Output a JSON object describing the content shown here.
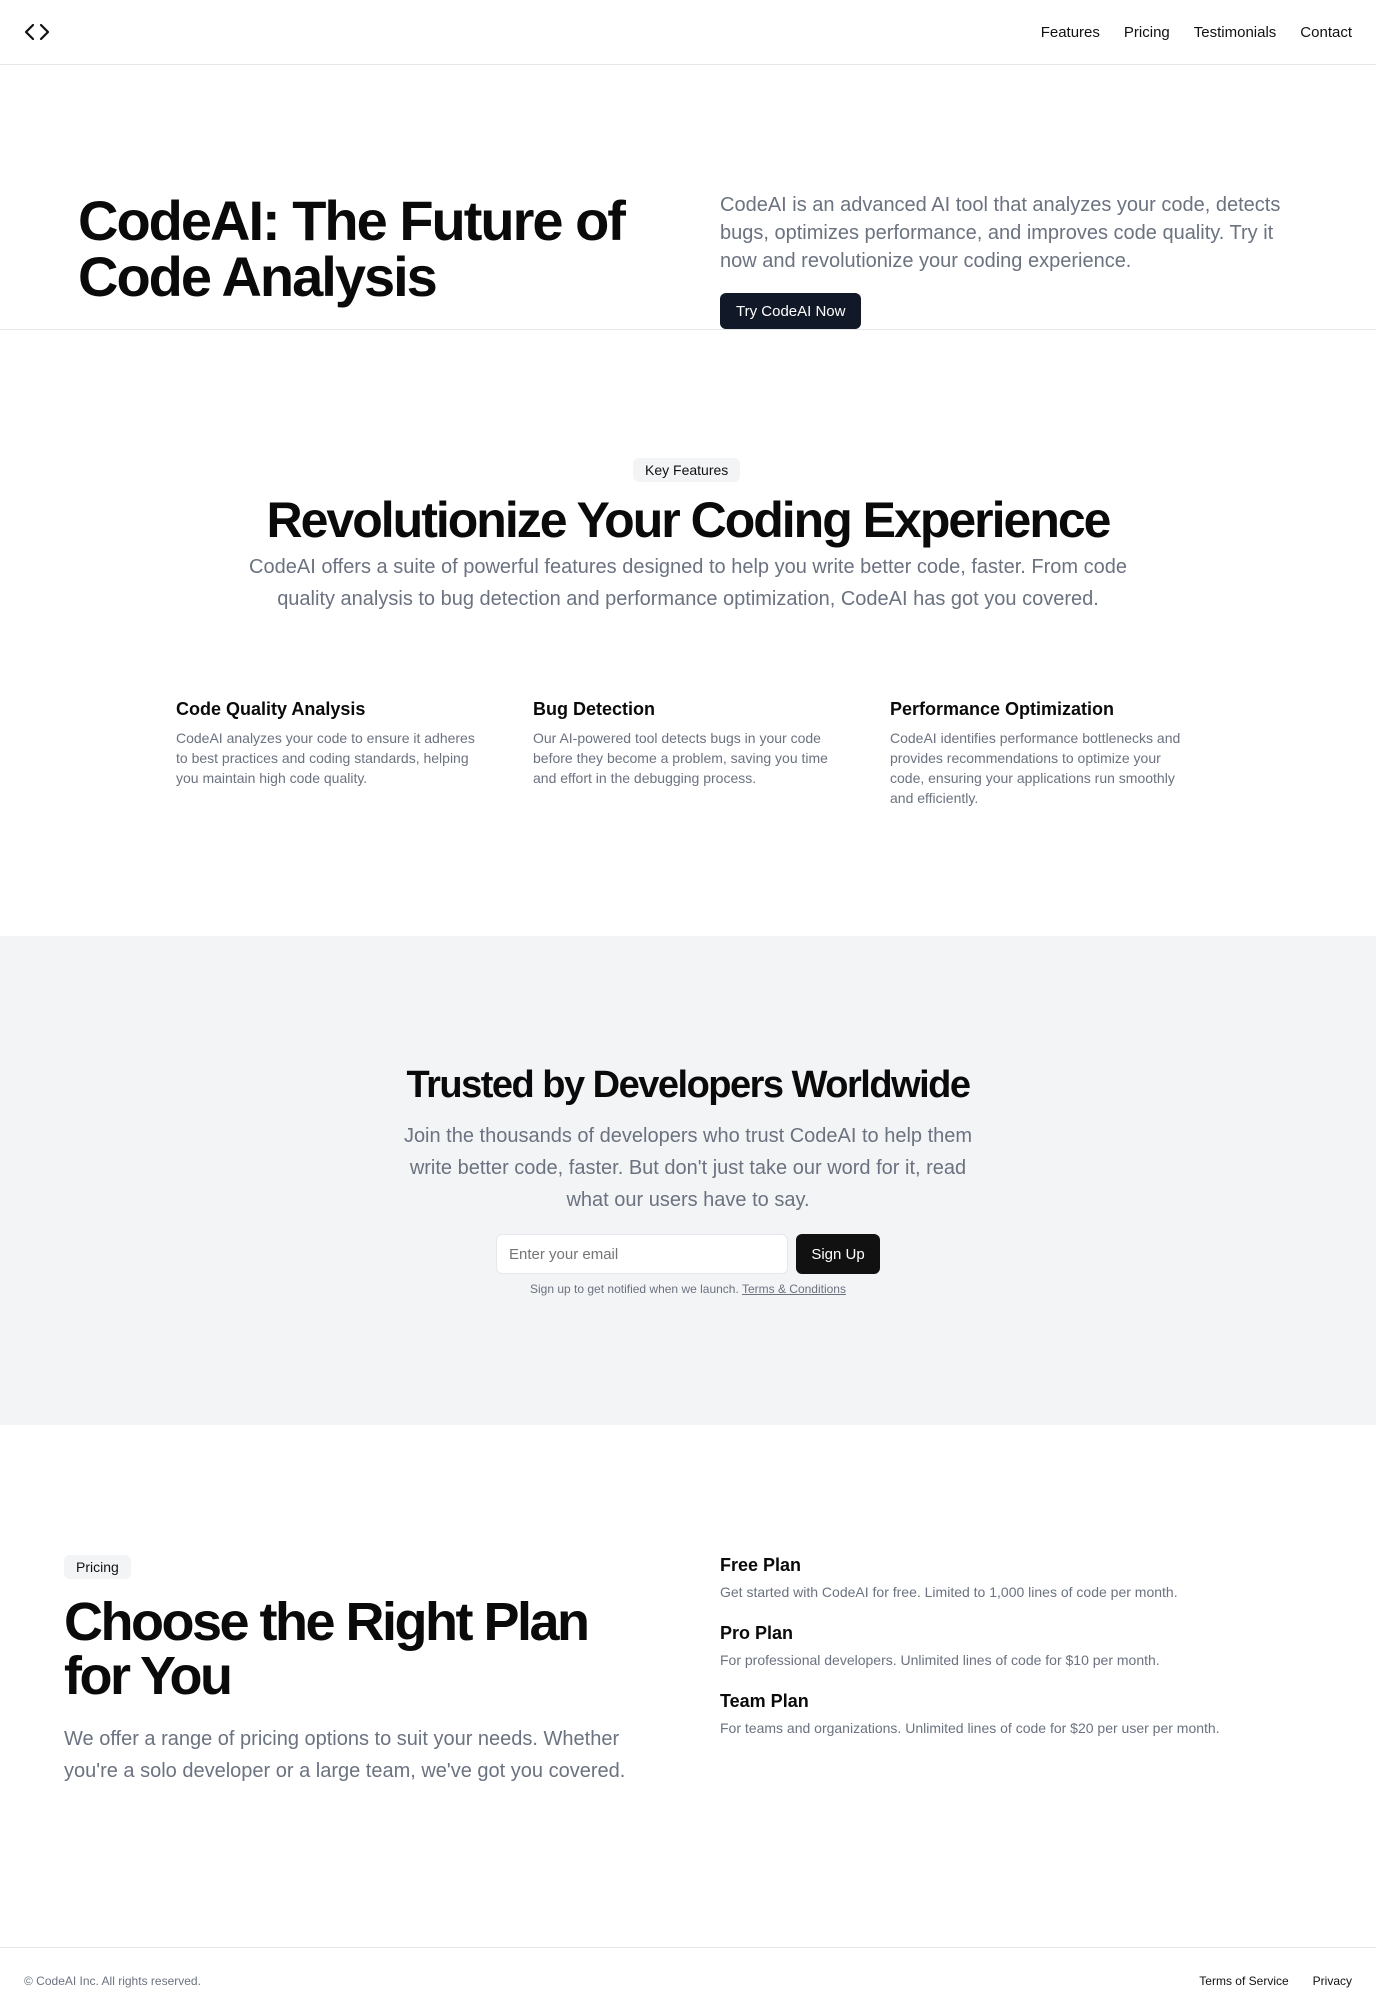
{
  "nav": {
    "items": [
      "Features",
      "Pricing",
      "Testimonials",
      "Contact"
    ]
  },
  "hero": {
    "title": "CodeAI: The Future of Code Analysis",
    "description": "CodeAI is an advanced AI tool that analyzes your code, detects bugs, optimizes performance, and improves code quality. Try it now and revolutionize your coding experience.",
    "cta_label": "Try CodeAI Now"
  },
  "features": {
    "badge": "Key Features",
    "title": "Revolutionize Your Coding Experience",
    "description": "CodeAI offers a suite of powerful features designed to help you write better code, faster. From code quality analysis to bug detection and performance optimization, CodeAI has got you covered.",
    "items": [
      {
        "title": "Code Quality Analysis",
        "text": "CodeAI analyzes your code to ensure it adheres to best practices and coding standards, helping you maintain high code quality."
      },
      {
        "title": "Bug Detection",
        "text": "Our AI-powered tool detects bugs in your code before they become a problem, saving you time and effort in the debugging process."
      },
      {
        "title": "Performance Optimization",
        "text": "CodeAI identifies performance bottlenecks and provides recommendations to optimize your code, ensuring your applications run smoothly and efficiently."
      }
    ]
  },
  "trusted": {
    "title": "Trusted by Developers Worldwide",
    "description": "Join the thousands of developers who trust CodeAI to help them write better code, faster. But don't just take our word for it, read what our users have to say.",
    "email_placeholder": "Enter your email",
    "signup_label": "Sign Up",
    "note": "Sign up to get notified when we launch.",
    "terms_link": "Terms & Conditions"
  },
  "pricing": {
    "badge": "Pricing",
    "title": "Choose the Right Plan for You",
    "description": "We offer a range of pricing options to suit your needs. Whether you're a solo developer or a large team, we've got you covered.",
    "plans": [
      {
        "name": "Free Plan",
        "text": "Get started with CodeAI for free. Limited to 1,000 lines of code per month."
      },
      {
        "name": "Pro Plan",
        "text": "For professional developers. Unlimited lines of code for $10 per month."
      },
      {
        "name": "Team Plan",
        "text": "For teams and organizations. Unlimited lines of code for $20 per user per month."
      }
    ]
  },
  "footer": {
    "copyright": "© CodeAI Inc. All rights reserved.",
    "links": [
      "Terms of Service",
      "Privacy"
    ]
  },
  "icons": {
    "logo": "code-brackets-icon"
  }
}
